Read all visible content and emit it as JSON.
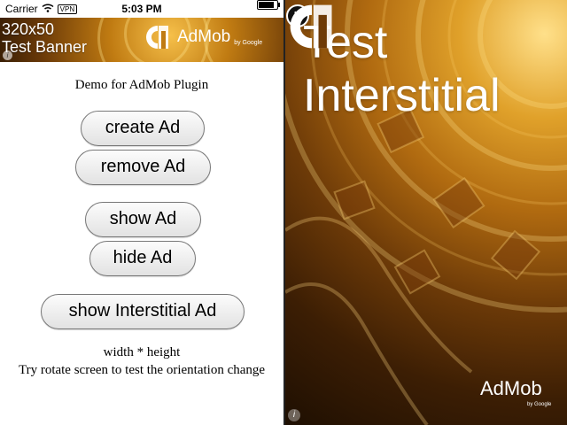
{
  "status_bar": {
    "carrier": "Carrier",
    "vpn": "VPN",
    "time": "5:03 PM",
    "battery_level": 0.85
  },
  "banner": {
    "line1": "320x50",
    "line2": "Test Banner",
    "brand": "AdMob",
    "by": "by Google",
    "info": "i"
  },
  "app": {
    "title": "Demo for AdMob Plugin",
    "buttons": {
      "create": "create Ad",
      "remove": "remove Ad",
      "show": "show Ad",
      "hide": "hide Ad",
      "show_interstitial": "show Interstitial Ad"
    },
    "caption1": "width * height",
    "caption2": "Try rotate screen to test the orientation change"
  },
  "interstitial": {
    "title_line1": "Test",
    "title_line2": "Interstitial",
    "close": "×",
    "brand": "AdMob",
    "by": "by Google",
    "info": "i"
  },
  "colors": {
    "admob_accent": "#e8a020",
    "background_gold": "#b06a10"
  }
}
